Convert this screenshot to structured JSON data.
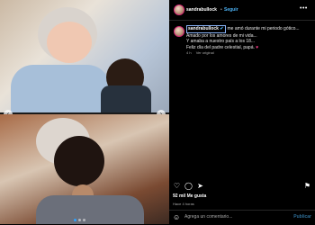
{
  "post": {
    "author": "sandrabullock",
    "separator": "•",
    "follow_label": "Seguir",
    "more_label": "•••"
  },
  "caption": {
    "username": "sandrabullock",
    "verified_icon": "verified-badge-icon",
    "line1": "me amó durante mi periodo gótico...",
    "line2": "Amado por los amores de mi vida...",
    "line3": "Y amaba a nuestro país a los 18...",
    "line4": "Feliz día del padre celestial, papá.",
    "heart": "♥",
    "time": "4 h",
    "translation_label": "Ver original"
  },
  "media": {
    "images": [
      "old-man-with-child-photo",
      "child-hugging-photo"
    ],
    "dots": [
      true,
      false,
      false
    ]
  },
  "engagement": {
    "likes": "92 mil Me gusta",
    "date": "Hace 4 horas"
  },
  "composer": {
    "placeholder": "Agrega un comentario...",
    "post_label": "Publicar"
  },
  "icons": {
    "like": "heart-outline-icon",
    "comment": "comment-icon",
    "share": "share-icon",
    "save": "bookmark-icon",
    "emoji": "emoji-icon"
  },
  "colors": {
    "link": "#4db5f9",
    "heart": "#ff3b8b",
    "background": "#000000"
  }
}
